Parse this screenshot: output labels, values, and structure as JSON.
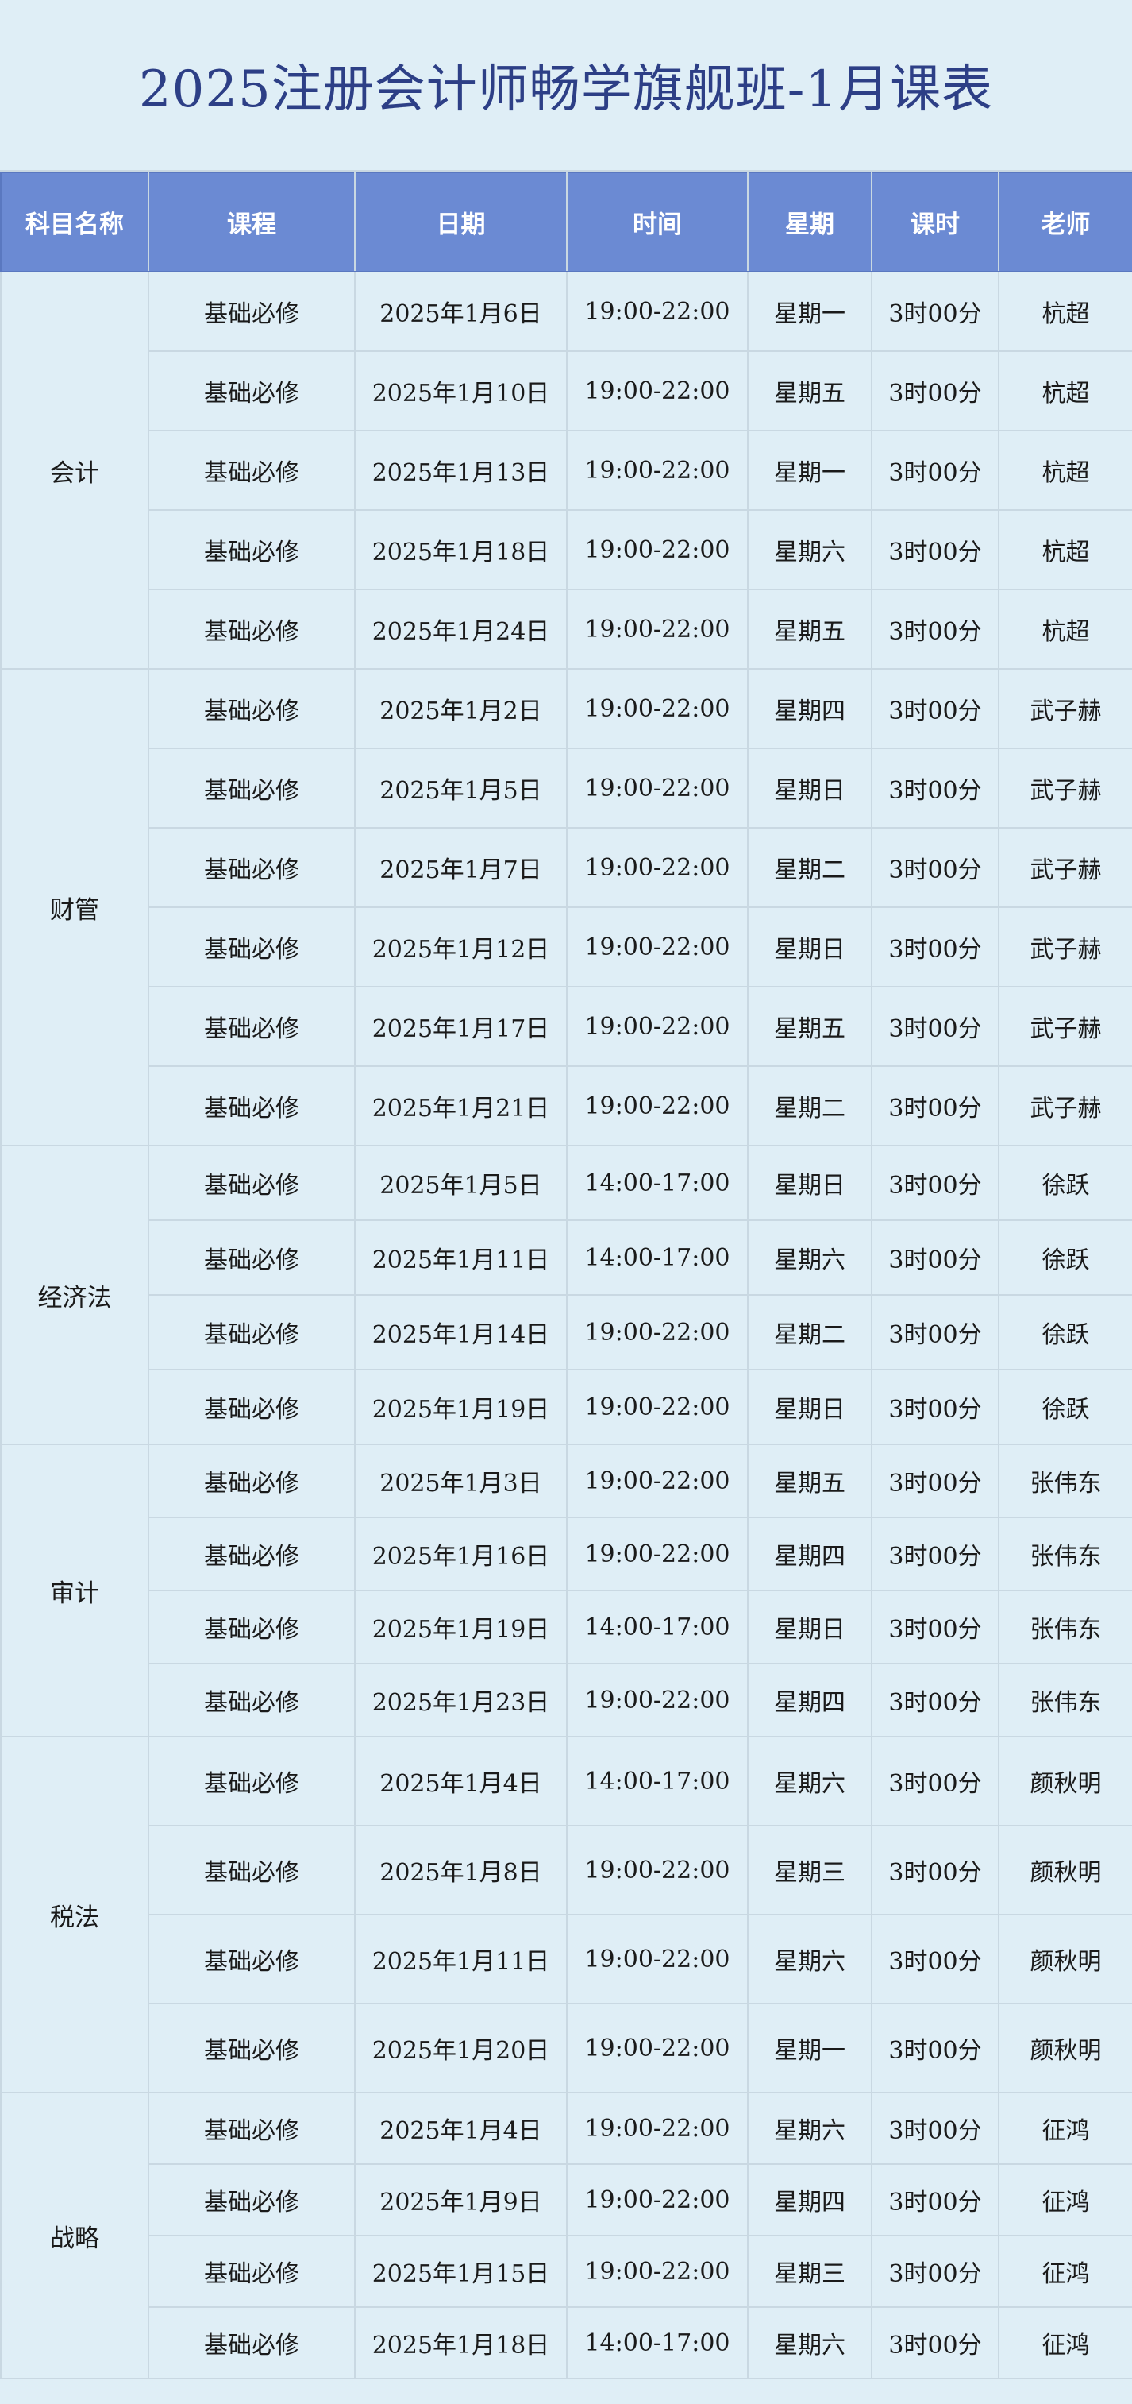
{
  "title": "2025注册会计师畅学旗舰班-1月课表",
  "headers": [
    "科目名称",
    "课程",
    "日期",
    "时间",
    "星期",
    "课时",
    "老师"
  ],
  "groups": [
    {
      "subject": "会计",
      "rows": [
        [
          "基础必修",
          "2025年1月6日",
          "19:00-22:00",
          "星期一",
          "3时00分",
          "杭超"
        ],
        [
          "基础必修",
          "2025年1月10日",
          "19:00-22:00",
          "星期五",
          "3时00分",
          "杭超"
        ],
        [
          "基础必修",
          "2025年1月13日",
          "19:00-22:00",
          "星期一",
          "3时00分",
          "杭超"
        ],
        [
          "基础必修",
          "2025年1月18日",
          "19:00-22:00",
          "星期六",
          "3时00分",
          "杭超"
        ],
        [
          "基础必修",
          "2025年1月24日",
          "19:00-22:00",
          "星期五",
          "3时00分",
          "杭超"
        ]
      ]
    },
    {
      "subject": "财管",
      "rows": [
        [
          "基础必修",
          "2025年1月2日",
          "19:00-22:00",
          "星期四",
          "3时00分",
          "武子赫"
        ],
        [
          "基础必修",
          "2025年1月5日",
          "19:00-22:00",
          "星期日",
          "3时00分",
          "武子赫"
        ],
        [
          "基础必修",
          "2025年1月7日",
          "19:00-22:00",
          "星期二",
          "3时00分",
          "武子赫"
        ],
        [
          "基础必修",
          "2025年1月12日",
          "19:00-22:00",
          "星期日",
          "3时00分",
          "武子赫"
        ],
        [
          "基础必修",
          "2025年1月17日",
          "19:00-22:00",
          "星期五",
          "3时00分",
          "武子赫"
        ],
        [
          "基础必修",
          "2025年1月21日",
          "19:00-22:00",
          "星期二",
          "3时00分",
          "武子赫"
        ]
      ]
    },
    {
      "subject": "经济法",
      "rows": [
        [
          "基础必修",
          "2025年1月5日",
          "14:00-17:00",
          "星期日",
          "3时00分",
          "徐跃"
        ],
        [
          "基础必修",
          "2025年1月11日",
          "14:00-17:00",
          "星期六",
          "3时00分",
          "徐跃"
        ],
        [
          "基础必修",
          "2025年1月14日",
          "19:00-22:00",
          "星期二",
          "3时00分",
          "徐跃"
        ],
        [
          "基础必修",
          "2025年1月19日",
          "19:00-22:00",
          "星期日",
          "3时00分",
          "徐跃"
        ]
      ]
    },
    {
      "subject": "审计",
      "rows": [
        [
          "基础必修",
          "2025年1月3日",
          "19:00-22:00",
          "星期五",
          "3时00分",
          "张伟东"
        ],
        [
          "基础必修",
          "2025年1月16日",
          "19:00-22:00",
          "星期四",
          "3时00分",
          "张伟东"
        ],
        [
          "基础必修",
          "2025年1月19日",
          "14:00-17:00",
          "星期日",
          "3时00分",
          "张伟东"
        ],
        [
          "基础必修",
          "2025年1月23日",
          "19:00-22:00",
          "星期四",
          "3时00分",
          "张伟东"
        ]
      ]
    },
    {
      "subject": "税法",
      "rows": [
        [
          "基础必修",
          "2025年1月4日",
          "14:00-17:00",
          "星期六",
          "3时00分",
          "颜秋明"
        ],
        [
          "基础必修",
          "2025年1月8日",
          "19:00-22:00",
          "星期三",
          "3时00分",
          "颜秋明"
        ],
        [
          "基础必修",
          "2025年1月11日",
          "19:00-22:00",
          "星期六",
          "3时00分",
          "颜秋明"
        ],
        [
          "基础必修",
          "2025年1月20日",
          "19:00-22:00",
          "星期一",
          "3时00分",
          "颜秋明"
        ]
      ]
    },
    {
      "subject": "战略",
      "rows": [
        [
          "基础必修",
          "2025年1月4日",
          "19:00-22:00",
          "星期六",
          "3时00分",
          "征鸿"
        ],
        [
          "基础必修",
          "2025年1月9日",
          "19:00-22:00",
          "星期四",
          "3时00分",
          "征鸿"
        ],
        [
          "基础必修",
          "2025年1月15日",
          "19:00-22:00",
          "星期三",
          "3时00分",
          "征鸿"
        ],
        [
          "基础必修",
          "2025年1月18日",
          "14:00-17:00",
          "星期六",
          "3时00分",
          "征鸿"
        ]
      ]
    }
  ],
  "colors": {
    "background": "#dfeef6",
    "header": "#6b8ad3",
    "title": "#2d3f86",
    "grid": "#c9d8e2"
  }
}
